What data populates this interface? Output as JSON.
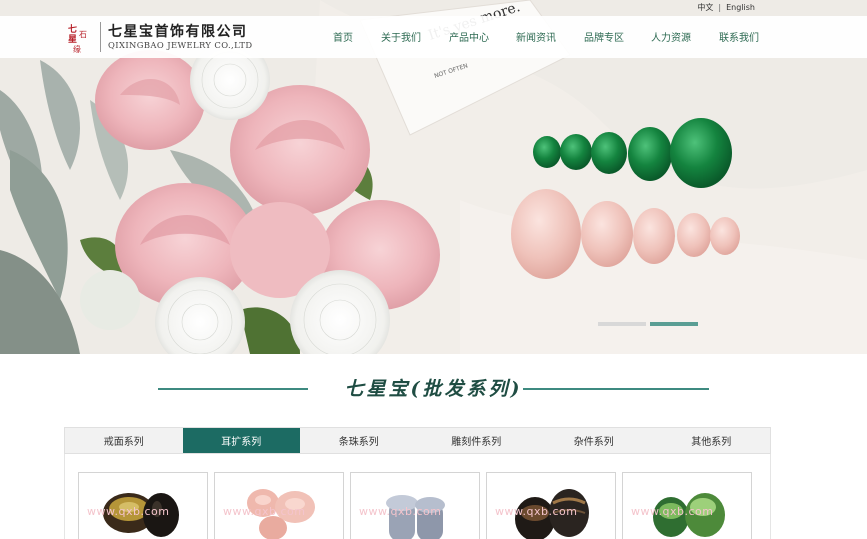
{
  "header": {
    "lang_cn": "中文",
    "lang_sep": "|",
    "lang_en": "English",
    "company_cn": "七星宝首饰有限公司",
    "company_en": "QIXINGBAO JEWELRY CO.,LTD",
    "seal_chars": [
      "七",
      "星",
      "石",
      "缘"
    ]
  },
  "banner_text": {
    "card_line1": "It's yes more.",
    "card_line2": "NOT OFTEN"
  },
  "nav": {
    "items": [
      "首页",
      "关于我们",
      "产品中心",
      "新闻资讯",
      "品牌专区",
      "人力资源",
      "联系我们"
    ]
  },
  "carousel": {
    "slide_count": 2,
    "active_index": 1
  },
  "section": {
    "title": "七星宝(批发系列)"
  },
  "tabs": {
    "items": [
      "戒面系列",
      "耳扩系列",
      "条珠系列",
      "雕刻件系列",
      "杂件系列",
      "其他系列"
    ],
    "active_index": 1
  },
  "products": {
    "watermark": "www.qxb.com",
    "items": [
      {
        "name": "dark-tiger-eye-plugs"
      },
      {
        "name": "pink-quartz-plugs"
      },
      {
        "name": "grey-agate-plugs"
      },
      {
        "name": "black-striped-plugs"
      },
      {
        "name": "green-jade-plugs"
      }
    ]
  },
  "colors": {
    "brand_green": "#1c6b63",
    "nav_text": "#2d6a52",
    "accent_line": "#3e8a80"
  }
}
